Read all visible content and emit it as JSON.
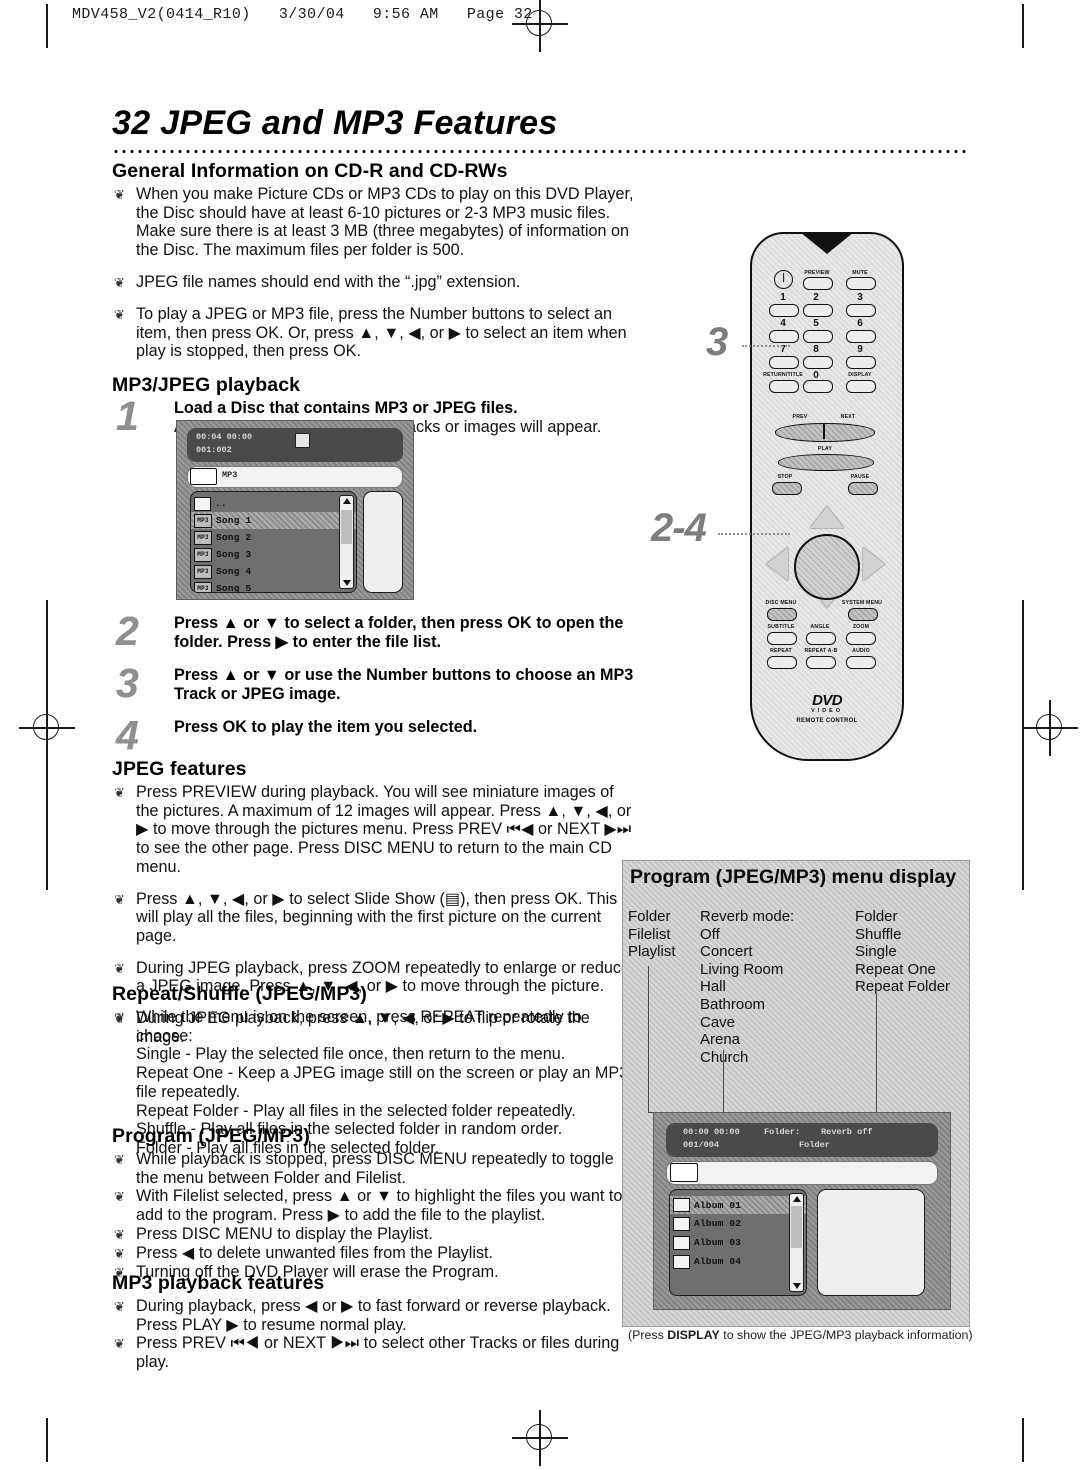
{
  "page": {
    "file_header": "MDV458_V2(0414_R10)   3/30/04   9:56 AM   Page 32",
    "title": "32  JPEG and MP3 Features"
  },
  "general": {
    "heading": "General Information on CD-R and CD-RWs",
    "bullets": [
      "When you make Picture CDs or MP3 CDs to play on this DVD Player, the Disc should have at least 6-10 pictures or 2-3 MP3 music files. Make sure there is at least 3 MB (three megabytes) of information on the Disc. The maximum files per folder is 500.",
      "JPEG file names should end with the “.jpg” extension.",
      "To play a JPEG or MP3 file, press the Number buttons to select an item, then press OK. Or, press ▲, ▼, ◀, or ▶ to select an item when play is stopped, then press OK."
    ]
  },
  "playback": {
    "heading": "MP3/JPEG playback",
    "steps": [
      {
        "num": "1",
        "bold": "Load a Disc that contains MP3 or JPEG files.",
        "text": "A menu that lists the available Tracks or images will  appear."
      },
      {
        "num": "2",
        "bold": "Press ▲ or ▼ to select a folder, then press OK to open the folder. Press ▶ to enter the file list.",
        "text": ""
      },
      {
        "num": "3",
        "bold": "Press ▲ or ▼ or use the Number buttons to choose an MP3 Track or JPEG image.",
        "text": ""
      },
      {
        "num": "4",
        "bold": "Press OK to play the item you selected.",
        "text": ""
      }
    ]
  },
  "screen_songs": {
    "time_primary": "00:04 00:00",
    "time_secondary": "001:002",
    "label_bar": "MP3",
    "parent_entry": "..",
    "items": [
      "Song 1",
      "Song 2",
      "Song 3",
      "Song 4",
      "Song 5"
    ],
    "item_icon": "MP3",
    "selected_index": 0
  },
  "jpeg_features": {
    "heading": "JPEG features",
    "bullets": [
      "Press PREVIEW during playback. You will see miniature images of the pictures.  A maximum of 12 images will appear. Press ▲, ▼, ◀, or ▶  to move through the pictures menu. Press PREV ⏮◀ or NEXT ▶⏭ to see the other page. Press DISC MENU to return to the main CD menu.",
      "Press ▲, ▼, ◀, or ▶ to select Slide Show (▤), then press OK. This will play all the files, beginning with the first picture on the current page.",
      "During JPEG playback, press ZOOM repeatedly to enlarge or reduce a JPEG image. Press ▲, ▼, ◀, or ▶ to move through the picture.",
      "During JPEG playback, press ▲, ▼, ◀, or ▶ to flip or rotate the image."
    ]
  },
  "repeat_shuffle": {
    "heading": "Repeat/Shuffle (JPEG/MP3)",
    "intro": "While the menu is on the screen, press REPEAT repeatedly to choose:",
    "modes": [
      "Single - Play the selected file once, then return to the menu.",
      "Repeat One - Keep a JPEG image still on the screen or play an MP3 file repeatedly.",
      "Repeat Folder - Play all files in the selected folder repeatedly.",
      "Shuffle - Play all files in the selected folder in random order.",
      "Folder - Play all files in the selected folder."
    ]
  },
  "program": {
    "heading": "Program (JPEG/MP3)",
    "bullets": [
      "While playback is stopped, press DISC MENU repeatedly to toggle the menu between Folder and Filelist.",
      "With Filelist selected, press ▲ or ▼ to highlight the files you want to add to the program. Press ▶ to add the file to the playlist.",
      "Press DISC MENU to display the Playlist.",
      "Press ◀ to delete unwanted files from the Playlist.",
      "Turning off the DVD Player will erase the Program."
    ]
  },
  "mp3_features": {
    "heading": "MP3 playback features",
    "bullets": [
      "During playback, press ◀ or ▶ to fast forward or reverse playback. Press PLAY ▶ to resume normal play.",
      "Press PREV ⏮◀ or NEXT ▶⏭ to select other Tracks or files during play."
    ]
  },
  "menu_panel": {
    "title": "Program (JPEG/MP3) menu display",
    "column_1": [
      "Folder",
      "Filelist",
      "Playlist"
    ],
    "column_2": [
      "Reverb mode:",
      "Off",
      "Concert",
      "Living Room",
      "Hall",
      "Bathroom",
      "Cave",
      "Arena",
      "Church"
    ],
    "column_3": [
      "Folder",
      "Shuffle",
      "Single",
      "Repeat One",
      "Repeat Folder"
    ],
    "caption_prefix": "(Press ",
    "caption_key": "DISPLAY",
    "caption_suffix": " to show the JPEG/MP3 playback information)"
  },
  "screen_albums": {
    "time_primary": "00:00 00:00",
    "time_secondary": "001/004",
    "osd_folder": "Folder:",
    "osd_reverb": "Reverb off",
    "osd_mode": "Folder",
    "items": [
      "Album 01",
      "Album 02",
      "Album 03",
      "Album 04"
    ],
    "selected_index": 0
  },
  "remote": {
    "callout_top": "3",
    "callout_bottom": "2-4",
    "power_label": "power-icon",
    "buttons_row1": [
      "PREVIEW",
      "MUTE"
    ],
    "numbers": [
      "1",
      "2",
      "3",
      "4",
      "5",
      "6",
      "7",
      "8",
      "9"
    ],
    "zero_row": [
      "RETURN/TITLE",
      "0",
      "DISPLAY"
    ],
    "transport": [
      "PREV",
      "NEXT",
      "PLAY",
      "STOP",
      "PAUSE"
    ],
    "menu_row": [
      "DISC MENU",
      "SYSTEM MENU"
    ],
    "feature_row1": [
      "SUBTITLE",
      "ANGLE",
      "ZOOM"
    ],
    "feature_row2": [
      "REPEAT",
      "REPEAT A-B",
      "AUDIO"
    ],
    "logo": "DVD",
    "logo_sub": "VIDEO",
    "footer": "REMOTE CONTROL"
  }
}
